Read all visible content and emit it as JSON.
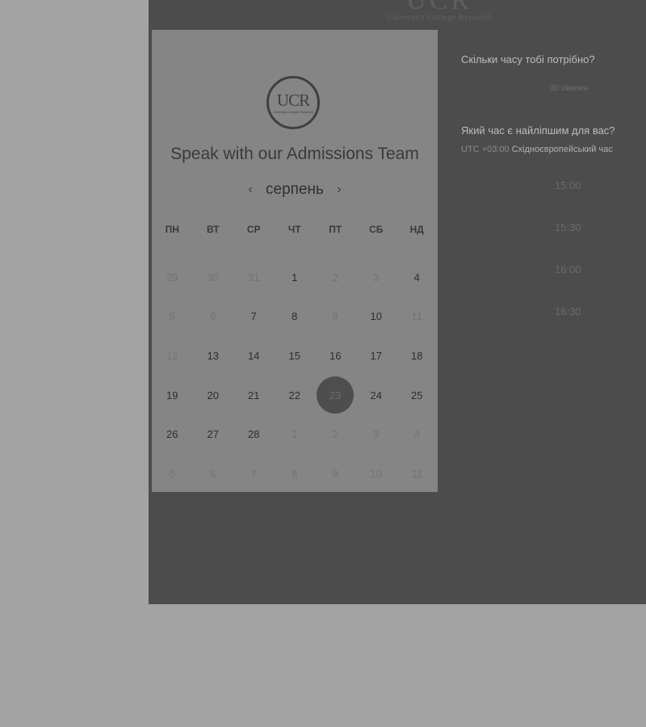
{
  "header": {
    "logo_text": "UCR",
    "logo_subtitle": "University College Research"
  },
  "card": {
    "logo_mark": "UCR",
    "logo_sub": "University College Research",
    "title": "Speak with our Admissions Team",
    "month": "серпень",
    "prev_icon": "‹",
    "next_icon": "›",
    "weekdays": [
      "ПН",
      "ВТ",
      "СР",
      "ЧТ",
      "ПТ",
      "СБ",
      "НД"
    ],
    "weeks": [
      [
        {
          "d": "29",
          "s": "dim"
        },
        {
          "d": "30",
          "s": "dim"
        },
        {
          "d": "31",
          "s": "dim"
        },
        {
          "d": "1",
          "s": "avail"
        },
        {
          "d": "2",
          "s": "dim"
        },
        {
          "d": "3",
          "s": "dim"
        },
        {
          "d": "4",
          "s": "avail"
        }
      ],
      [
        {
          "d": "5",
          "s": "dim"
        },
        {
          "d": "6",
          "s": "dim"
        },
        {
          "d": "7",
          "s": "avail"
        },
        {
          "d": "8",
          "s": "avail"
        },
        {
          "d": "9",
          "s": "dim"
        },
        {
          "d": "10",
          "s": "avail"
        },
        {
          "d": "11",
          "s": "dim"
        }
      ],
      [
        {
          "d": "12",
          "s": "dim"
        },
        {
          "d": "13",
          "s": "avail"
        },
        {
          "d": "14",
          "s": "avail"
        },
        {
          "d": "15",
          "s": "avail"
        },
        {
          "d": "16",
          "s": "avail"
        },
        {
          "d": "17",
          "s": "avail"
        },
        {
          "d": "18",
          "s": "avail"
        }
      ],
      [
        {
          "d": "19",
          "s": "avail"
        },
        {
          "d": "20",
          "s": "avail"
        },
        {
          "d": "21",
          "s": "avail"
        },
        {
          "d": "22",
          "s": "avail"
        },
        {
          "d": "23",
          "s": "sel"
        },
        {
          "d": "24",
          "s": "avail"
        },
        {
          "d": "25",
          "s": "avail"
        }
      ],
      [
        {
          "d": "26",
          "s": "avail"
        },
        {
          "d": "27",
          "s": "avail"
        },
        {
          "d": "28",
          "s": "avail"
        },
        {
          "d": "1",
          "s": "dim"
        },
        {
          "d": "2",
          "s": "dim"
        },
        {
          "d": "3",
          "s": "dim"
        },
        {
          "d": "4",
          "s": "dim"
        }
      ],
      [
        {
          "d": "5",
          "s": "dim"
        },
        {
          "d": "6",
          "s": "dim"
        },
        {
          "d": "7",
          "s": "dim"
        },
        {
          "d": "8",
          "s": "dim"
        },
        {
          "d": "9",
          "s": "dim"
        },
        {
          "d": "10",
          "s": "dim"
        },
        {
          "d": "11",
          "s": "dim"
        }
      ]
    ]
  },
  "booking": {
    "duration_question": "Скільки часу тобі потрібно?",
    "duration_value": "30 хвилин",
    "time_question": "Який час є найліпшим для вас?",
    "timezone_offset": "UTC +03:00",
    "timezone_name": "Східноєвропейський час",
    "slots": [
      "15:00",
      "15:30",
      "16:00",
      "16:30"
    ]
  }
}
